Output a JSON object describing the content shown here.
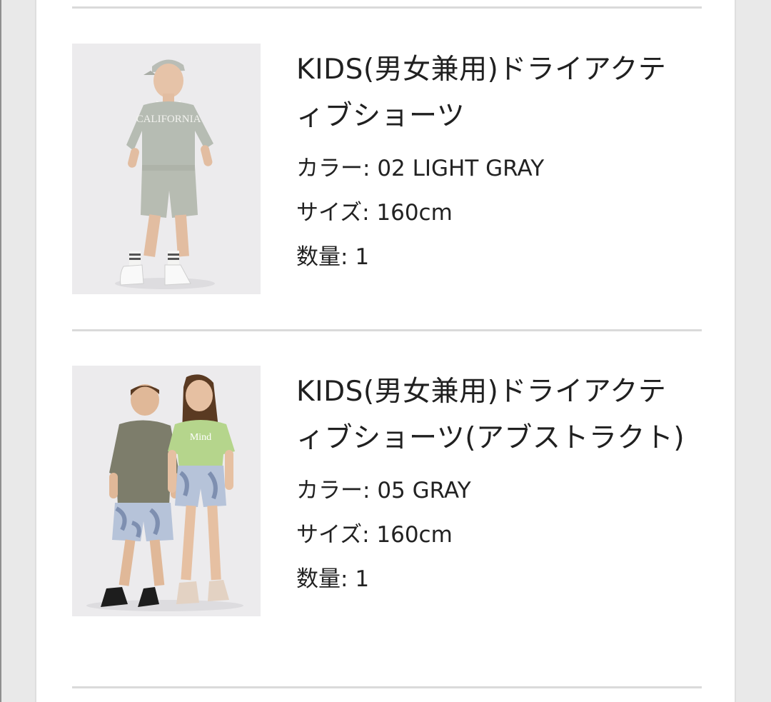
{
  "items": [
    {
      "title": "KIDS(男女兼用)ドライアクティブショーツ",
      "color_label": "カラー",
      "color_value": "02 LIGHT GRAY",
      "size_label": "サイズ",
      "size_value": "160cm",
      "qty_label": "数量",
      "qty_value": "1",
      "image": "product-photo-boy-gray-shorts",
      "shirt_print": "CALIFORNIA"
    },
    {
      "title": "KIDS(男女兼用)ドライアクティブショーツ(アブストラクト)",
      "color_label": "カラー",
      "color_value": "05 GRAY",
      "size_label": "サイズ",
      "size_value": "160cm",
      "qty_label": "数量",
      "qty_value": "1",
      "image": "product-photo-two-kids-abstract-shorts",
      "shirt_print": "Mind"
    }
  ],
  "separator": ": ",
  "colors": {
    "background": "#e9e9e9",
    "panel": "#ffffff",
    "divider": "#dadada",
    "text": "#212121"
  }
}
